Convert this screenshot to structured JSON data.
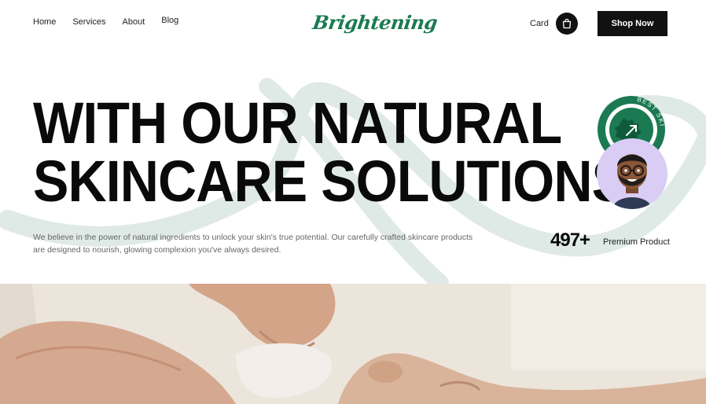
{
  "nav": {
    "links": [
      "Home",
      "Services",
      "About",
      "Blog"
    ],
    "logo": "Brightening",
    "card_label": "Card",
    "cart_icon": "shopping-bag-icon",
    "shop_button": "Shop Now"
  },
  "hero": {
    "headline_line1": "WITH OUR NATURAL",
    "headline_line2": "SKINCARE SOLUTIONS",
    "description": "We believe in the power of natural ingredients to unlock your skin's true potential. Our carefully crafted skincare products are designed to nourish, glowing complexion you've always desired.",
    "stat_number": "497+",
    "stat_label": "Premium Product",
    "badge_text": "BEST SKI"
  },
  "colors": {
    "accent_green": "#1b7a52",
    "swoosh": "#dfeae7",
    "avatar_bg": "#d9cdf5",
    "button_bg": "#111111"
  }
}
